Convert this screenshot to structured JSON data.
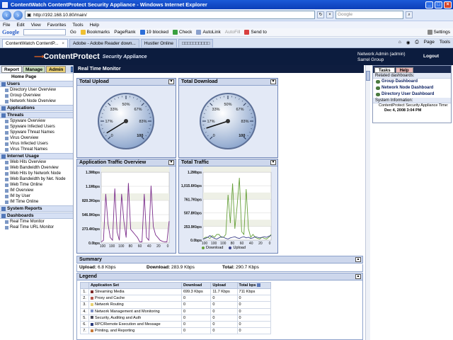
{
  "browser": {
    "title": "ContentWatch ContentProtect Security Appliance - Windows Internet Explorer",
    "url": "http://192.168.10.80/main/",
    "search_placeholder": "Google",
    "menus": [
      "File",
      "Edit",
      "View",
      "Favorites",
      "Tools",
      "Help"
    ],
    "toolbar": {
      "google": "Google",
      "go": "Go",
      "bookmarks": "Bookmarks",
      "pagerank": "PageRank",
      "blocked": "19 blocked",
      "check": "Check",
      "autolink": "AutoLink",
      "autofill": "AutoFill",
      "sendto": "Send to",
      "settings": "Settings"
    },
    "tabs": [
      {
        "label": "ContentWatch ContentP..."
      },
      {
        "label": "Adobe - Adobe Reader down..."
      },
      {
        "label": "Hustler Online"
      },
      {
        "label": "□□□□□□□□□□"
      }
    ],
    "right_tools": {
      "page": "Page",
      "tools": "Tools"
    }
  },
  "app": {
    "logo": "ContentProtect",
    "logo_sub": "Security Appliance",
    "user": "Network Admin (admin)",
    "user2": "Sarrel Group",
    "logout": "Logout"
  },
  "nav": {
    "tabs": [
      "Report",
      "Manage",
      "Admin"
    ],
    "home": "Home Page",
    "sections": [
      {
        "title": "Users",
        "items": [
          "Directory User Overview",
          "Group Overview",
          "Network Node Overview"
        ]
      },
      {
        "title": "Applications",
        "items": []
      },
      {
        "title": "Threats",
        "items": [
          "Spyware Overview",
          "Spyware Infected Users",
          "Spyware Threat Names",
          "Virus Overview",
          "Virus Infected Users",
          "Virus Threat Names"
        ]
      },
      {
        "title": "Internet Usage",
        "items": [
          "Web Hits Overview",
          "Web Bandwidth Overview",
          "Web Hits by Network Node",
          "Web Bandwidth by Net. Node",
          "Web Time Online",
          "IM Overview",
          "IM by User",
          "IM Time Online"
        ]
      },
      {
        "title": "System Reports",
        "items": []
      },
      {
        "title": "Dashboards",
        "items": [
          "Real Time Monitor",
          "Real Time URL Monitor"
        ]
      }
    ]
  },
  "main": {
    "title": "Real Time Monitor",
    "panels": {
      "upload": "Total Upload",
      "download": "Total Download",
      "app_traffic": "Application Traffic Overview",
      "total_traffic": "Total Traffic"
    },
    "summary": {
      "title": "Summary",
      "upload_label": "Upload:",
      "upload_value": "6.8 Kbps",
      "download_label": "Download:",
      "download_value": "283.9 Kbps",
      "total_label": "Total:",
      "total_value": "290.7 Kbps"
    },
    "legend": {
      "title": "Legend",
      "columns": [
        "Application Set",
        "Download",
        "Upload",
        "Total bps"
      ],
      "rows": [
        {
          "idx": "1.",
          "name": "Streaming Media",
          "color": "#7b2a2a",
          "download": "699.3 Kbps",
          "upload": "11.7 Kbps",
          "total": "711 Kbps"
        },
        {
          "idx": "2.",
          "name": "Proxy and Cache",
          "color": "#b5574c",
          "download": "0",
          "upload": "0",
          "total": "0"
        },
        {
          "idx": "3.",
          "name": "Network Routing",
          "color": "#e8d070",
          "download": "0",
          "upload": "0",
          "total": "0"
        },
        {
          "idx": "4.",
          "name": "Network Management and Monitoring",
          "color": "#7a90c8",
          "download": "0",
          "upload": "0",
          "total": "0"
        },
        {
          "idx": "5.",
          "name": "Security, Auditing and Auth",
          "color": "#4a4a5a",
          "download": "0",
          "upload": "0",
          "total": "0"
        },
        {
          "idx": "6.",
          "name": "RPC/Remote Execution and Message",
          "color": "#2a3a7a",
          "download": "0",
          "upload": "0",
          "total": "0"
        },
        {
          "idx": "7.",
          "name": "Printing, and Reporting",
          "color": "#c87a3a",
          "download": "0",
          "upload": "0",
          "total": "0"
        }
      ]
    }
  },
  "gauges": [
    {
      "ticks": [
        "17%",
        "33%",
        "50%",
        "67%",
        "83%",
        "100"
      ],
      "zero": "0",
      "value_fraction": 0.05
    },
    {
      "ticks": [
        "17%",
        "33%",
        "50%",
        "67%",
        "83%",
        "100"
      ],
      "zero": "0",
      "value_fraction": 0.1
    }
  ],
  "chart_data": [
    {
      "type": "line",
      "title": "Application Traffic Overview",
      "ylabels": [
        "0.0bps",
        "273.4Kbps",
        "546.9Kbps",
        "820.3Kbps",
        "1.1Mbps",
        "1.3Mbps"
      ],
      "xlabels": [
        "100",
        "100",
        "100",
        "80",
        "60",
        "40",
        "20",
        "0"
      ],
      "ylim": [
        0,
        1.3
      ],
      "series": [
        {
          "color": "#7b2d8b",
          "values": [
            0.02,
            0.05,
            0.9,
            0.35,
            0.1,
            0.05,
            1.0,
            0.2,
            0.05,
            0.9,
            0.4,
            0.1,
            1.1,
            0.25,
            0.2,
            0.15,
            0.1,
            0.02,
            0.02,
            0.9,
            0.1,
            0.05,
            1.05,
            0.3,
            0.15,
            0.1,
            0.05,
            0.03,
            0.02,
            0.02,
            0.4
          ]
        }
      ]
    },
    {
      "type": "line",
      "title": "Total Traffic",
      "ylabels": [
        "0.0bps",
        "253.9Kbps",
        "507.8Kbps",
        "761.7Kbps",
        "1,015.6Kbps",
        "1.2Mbps"
      ],
      "xlabels": [
        "100",
        "100",
        "100",
        "80",
        "60",
        "40",
        "20",
        "0"
      ],
      "ylim": [
        0,
        1.2
      ],
      "series": [
        {
          "name": "Download",
          "color": "#66a03a",
          "values": [
            0.02,
            0.05,
            0.05,
            0.03,
            0.08,
            0.05,
            0.1,
            0.1,
            0.05,
            0.05,
            0.1,
            0.8,
            0.3,
            1.0,
            0.2,
            0.6,
            1.1,
            0.15,
            0.1,
            0.9,
            0.2,
            0.05,
            0.1,
            0.05,
            0.03,
            0.02,
            0.05,
            0.03,
            0.02,
            0.05,
            0.1
          ]
        },
        {
          "name": "Upload",
          "color": "#3a3f8a",
          "values": [
            0.02,
            0.03,
            0.05,
            0.08,
            0.05,
            0.03,
            0.02,
            0.04,
            0.06,
            0.05,
            0.03,
            0.02,
            0.04,
            0.05,
            0.06,
            0.04,
            0.03,
            0.05,
            0.06,
            0.04,
            0.05,
            0.03,
            0.04,
            0.06,
            0.05,
            0.04,
            0.05,
            0.06,
            0.05,
            0.07,
            0.08
          ]
        }
      ]
    }
  ],
  "tasks": {
    "tabs": [
      "Tasks",
      "Help"
    ],
    "related_title": "Related dashboards:",
    "links": [
      "Group Dashboard",
      "Network Node Dashboard",
      "Directory User Dashboard"
    ],
    "sysinfo_title": "System Information:",
    "sysinfo_line1": "ContentProtect Security Appliance Time:",
    "sysinfo_line2": "Dec 4, 2008 3:04 PM"
  }
}
